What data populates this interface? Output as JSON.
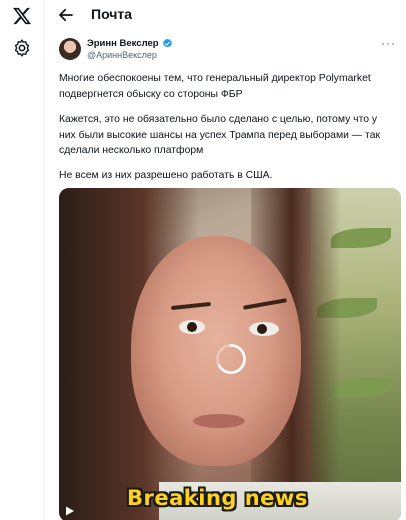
{
  "nav": {
    "logo_icon": "x-logo-icon",
    "settings_icon": "gear-icon"
  },
  "header": {
    "back_icon": "arrow-left-icon",
    "title": "Почта"
  },
  "tweet": {
    "author_name": "Эринн Векслер",
    "author_handle": "@АриннВекслер",
    "verified_color": "#1d9bf0",
    "more_label": "···",
    "paragraphs": [
      "Многие обеспокоены тем, что генеральный директор Polymarket подвергнется обыску со стороны ФБР",
      "Кажется, это не обязательно было сделано с целью, потому что у них были высокие шансы на успех Трампа перед выборами — так сделали несколько платформ",
      "Не всем из них разрешено работать в США."
    ],
    "media": {
      "caption": "Breaking news",
      "caption_color": "#ffd21e",
      "loading_icon": "spinner-icon",
      "play_icon": "play-icon"
    }
  }
}
